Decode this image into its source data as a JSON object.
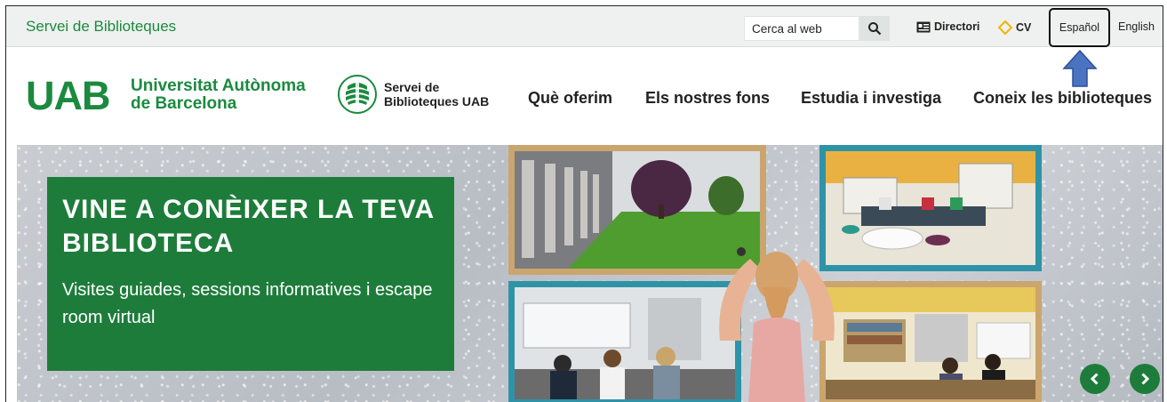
{
  "topbar": {
    "site_name": "Servei de Biblioteques",
    "search_placeholder": "Cerca al web",
    "directory_label": "Directori",
    "cv_label": "CV",
    "lang_es": "Español",
    "lang_en": "English"
  },
  "header": {
    "uab_mark": "UAB",
    "uab_name_line1": "Universitat Autònoma",
    "uab_name_line2": "de Barcelona",
    "lib_name_line1": "Servei de",
    "lib_name_line2": "Biblioteques UAB",
    "nav": [
      "Què oferim",
      "Els nostres fons",
      "Estudia i investiga",
      "Coneix les biblioteques"
    ]
  },
  "hero": {
    "title": "VINE A CONÈIXER LA TEVA BIBLIOTECA",
    "subtitle": "Visites guiades, sessions informatives i escape room virtual"
  },
  "colors": {
    "brand_green": "#1b8a3f",
    "promo_green": "#1e7c3b",
    "arrow_blue": "#4a73c2"
  },
  "icons": [
    "search-icon",
    "directory-icon",
    "cv-diamond-icon",
    "library-logo-icon",
    "prev-slide-icon",
    "next-slide-icon",
    "pointer-arrow-icon"
  ]
}
